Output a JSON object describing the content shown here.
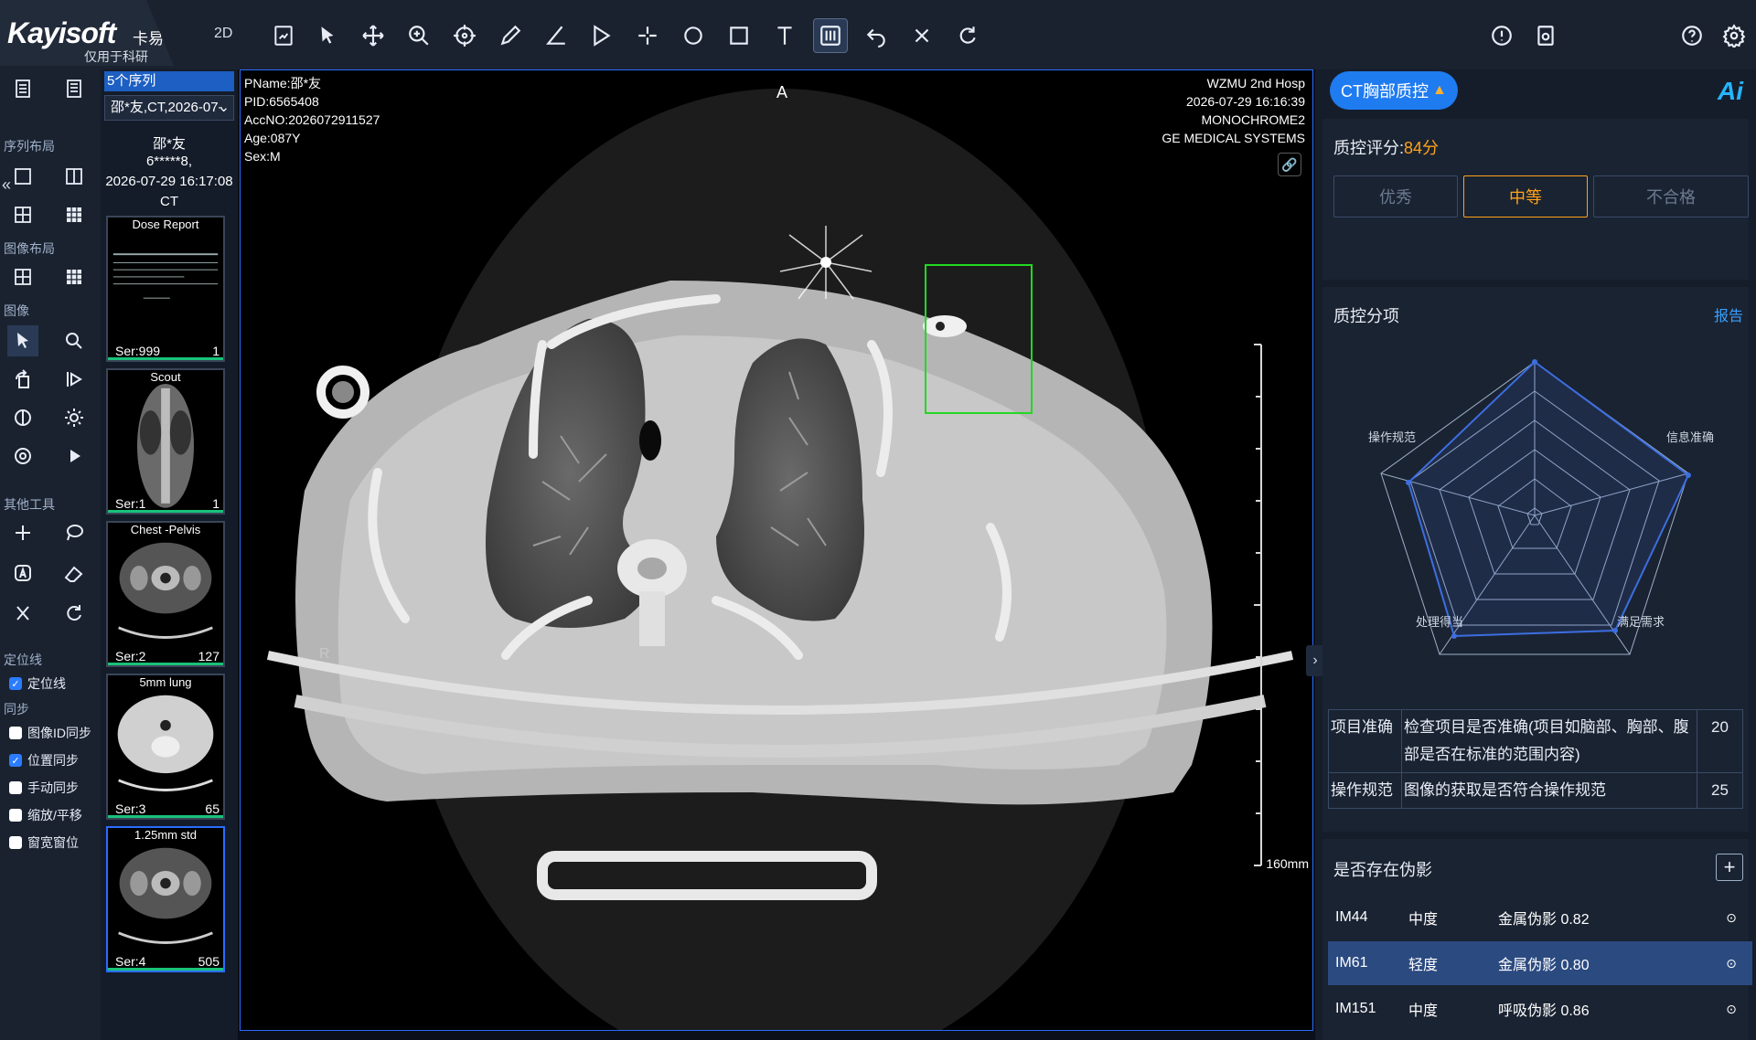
{
  "app": {
    "brand": "Kayisoft",
    "brand_cn": "卡易",
    "subtitle": "仅用于科研",
    "mode": "2D"
  },
  "toolbar": {
    "icons": [
      "screenshot-icon",
      "pointer-icon",
      "pan-icon",
      "zoom-icon",
      "crosshair-icon",
      "pencil-icon",
      "angle-icon",
      "triangle-icon",
      "crosshair-plus-icon",
      "circle-icon",
      "rectangle-icon",
      "text-icon",
      "adjust-icon",
      "undo-icon",
      "close-icon",
      "reset-icon",
      "info-icon",
      "save-icon",
      "help-icon",
      "settings-icon"
    ]
  },
  "left_panel": {
    "sections": {
      "series_layout": "序列布局",
      "image_layout": "图像布局",
      "image": "图像",
      "other_tools": "其他工具",
      "locator": "定位线",
      "sync": "同步"
    },
    "locator_checkbox": "定位线",
    "sync_options": [
      {
        "label": "图像ID同步",
        "checked": false
      },
      {
        "label": "位置同步",
        "checked": true
      },
      {
        "label": "手动同步",
        "checked": false
      },
      {
        "label": "缩放/平移",
        "checked": false
      },
      {
        "label": "窗宽窗位",
        "checked": false
      }
    ]
  },
  "series_panel": {
    "count_label": "5个序列",
    "select_value": "邵*友,CT,2026-07-",
    "patient_name": "邵*友",
    "patient_id": "6*****8,",
    "study_datetime": "2026-07-29 16:17:08",
    "modality": "CT",
    "thumbnails": [
      {
        "name": "Dose Report",
        "series": "Ser:999",
        "count": "1"
      },
      {
        "name": "Scout",
        "series": "Ser:1",
        "count": "1"
      },
      {
        "name": "Chest -Pelvis",
        "series": "Ser:2",
        "count": "127"
      },
      {
        "name": "5mm lung",
        "series": "Ser:3",
        "count": "65"
      },
      {
        "name": "1.25mm std",
        "series": "Ser:4",
        "count": "505"
      }
    ]
  },
  "viewer": {
    "overlay_left": [
      "PName:邵*友",
      "PID:6565408",
      "AccNO:2026072911527",
      "Age:087Y",
      "Sex:M"
    ],
    "overlay_right": [
      "WZMU 2nd Hosp",
      "2026-07-29 16:16:39",
      "MONOCHROME2",
      "GE MEDICAL SYSTEMS"
    ],
    "orientation_top": "A",
    "orientation_left": "R",
    "scale_label": "160mm"
  },
  "qc_panel": {
    "tab_label": "CT胸部质控",
    "ai_label": "Ai",
    "score_label": "质控评分:",
    "score_value": "84分",
    "grades": [
      {
        "label": "优秀",
        "selected": false
      },
      {
        "label": "中等",
        "selected": true
      },
      {
        "label": "不合格",
        "selected": false
      }
    ],
    "sub_title": "质控分项",
    "report_link": "报告",
    "radar_labels": [
      "操作规范",
      "信息准确",
      "满足需求",
      "处理得当"
    ],
    "table": [
      {
        "category": "项目准确",
        "description": "检查项目是否准确(项目如脑部、胸部、腹部是否在标准的范围内容)",
        "score": "20"
      },
      {
        "category": "操作规范",
        "description": "图像的获取是否符合操作规范",
        "score": "25"
      }
    ],
    "artifact_title": "是否存在伪影",
    "artifacts": [
      {
        "id": "IM44",
        "level": "中度",
        "type": "金属伪影 0.82",
        "selected": false
      },
      {
        "id": "IM61",
        "level": "轻度",
        "type": "金属伪影 0.80",
        "selected": true
      },
      {
        "id": "IM151",
        "level": "中度",
        "type": "呼吸伪影 0.86",
        "selected": false
      }
    ]
  },
  "colors": {
    "accent": "#1f7bf0",
    "warning": "#ffa31a",
    "qc_box": "#22d822",
    "selected_row": "#2b4a80"
  }
}
